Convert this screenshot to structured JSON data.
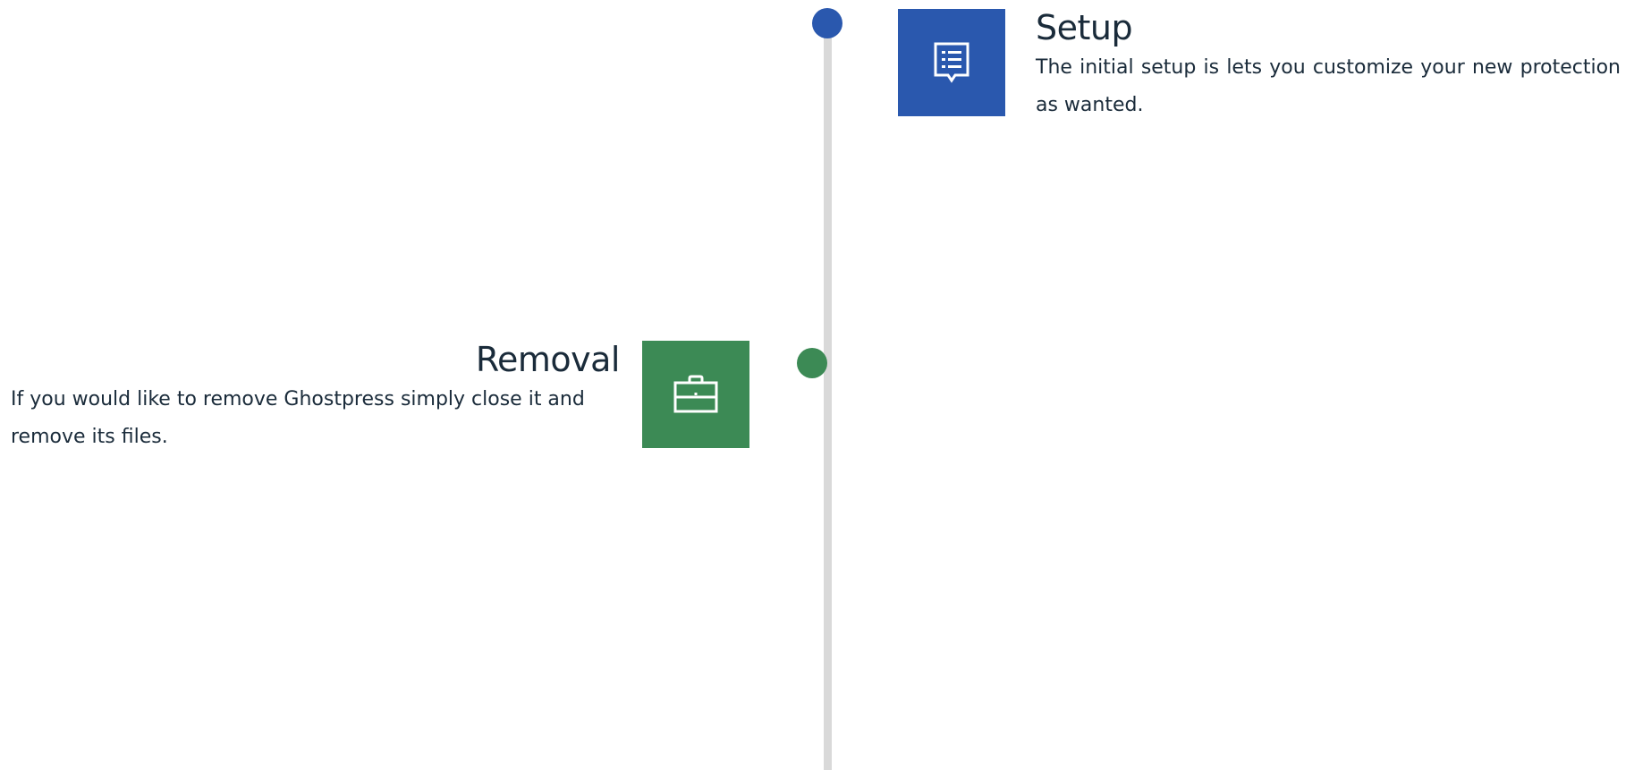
{
  "colors": {
    "setup_accent": "#2a58ae",
    "removal_accent": "#3c8a55",
    "timeline_line": "#d9d9d9"
  },
  "timeline": {
    "items": [
      {
        "title": "Setup",
        "description": "The initial setup is lets you customize your new protection as wanted.",
        "icon": "list-document-icon"
      },
      {
        "title": "Removal",
        "description": "If you would like to remove Ghostpress simply close it and remove its files.",
        "icon": "briefcase-icon"
      }
    ]
  }
}
